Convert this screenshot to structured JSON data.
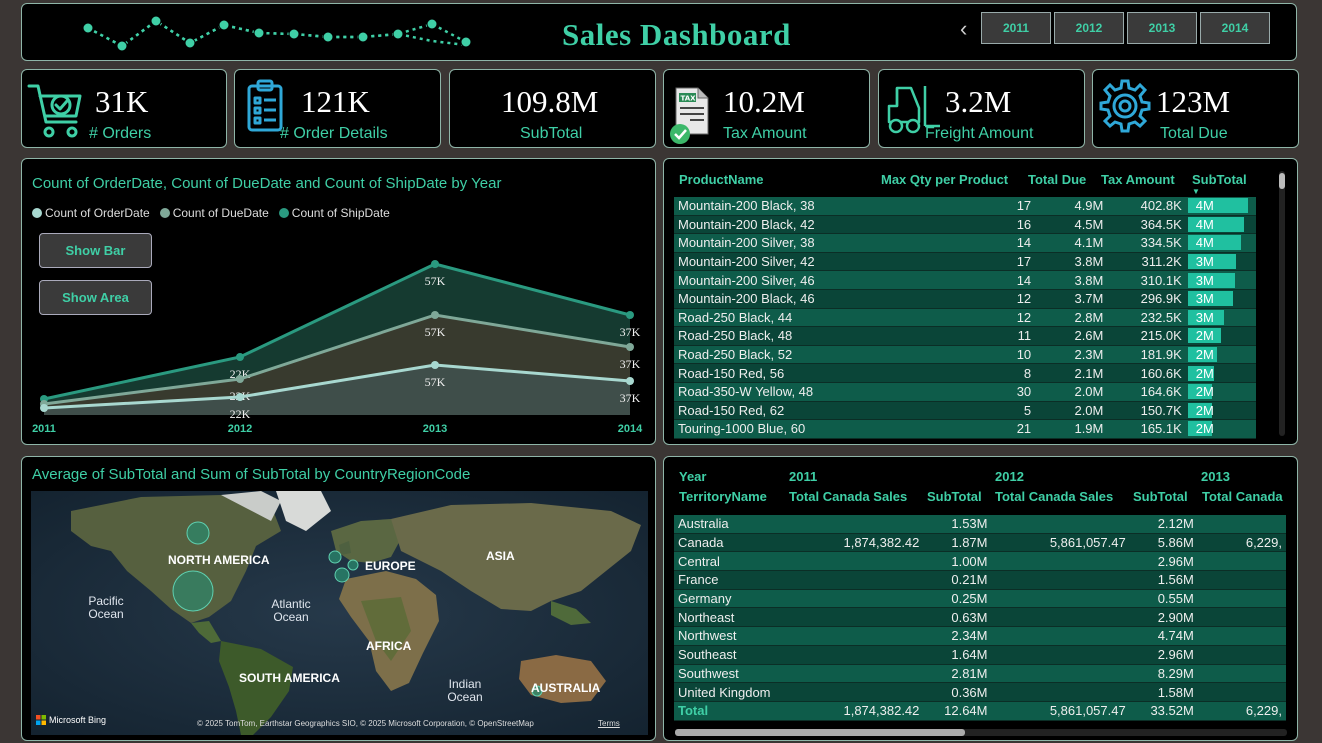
{
  "header": {
    "title": "Sales Dashboard",
    "years": [
      "2011",
      "2012",
      "2013",
      "2014"
    ]
  },
  "kpis": [
    {
      "value": "31K",
      "label": "# Orders",
      "icon": "cart-check-icon"
    },
    {
      "value": "121K",
      "label": "# Order Details",
      "icon": "clipboard-list-icon"
    },
    {
      "value": "109.8M",
      "label": "SubTotal",
      "icon": ""
    },
    {
      "value": "10.2M",
      "label": "Tax Amount",
      "icon": "tax-document-icon"
    },
    {
      "value": "3.2M",
      "label": "Freight Amount",
      "icon": "forklift-icon"
    },
    {
      "value": "123M",
      "label": "Total Due",
      "icon": "gear-icon"
    }
  ],
  "line_chart": {
    "title": "Count of OrderDate, Count of DueDate and Count of ShipDate by Year",
    "buttons": {
      "show_bar": "Show Bar",
      "show_area": "Show Area"
    }
  },
  "chart_data": {
    "type": "area",
    "title": "Count of OrderDate, Count of DueDate and Count of ShipDate by Year",
    "categories": [
      "2011",
      "2012",
      "2013",
      "2014"
    ],
    "series": [
      {
        "name": "Count of OrderDate",
        "color": "#a8d8d0",
        "values": [
          1600,
          22000,
          57000,
          37000
        ],
        "labels": [
          "",
          "22K",
          "57K",
          "37K"
        ]
      },
      {
        "name": "Count of DueDate",
        "color": "#7fa898",
        "values": [
          1700,
          22000,
          57000,
          37000
        ],
        "labels": [
          "",
          "22K",
          "57K",
          "37K"
        ]
      },
      {
        "name": "Count of ShipDate",
        "color": "#2a9a80",
        "values": [
          1800,
          22000,
          57000,
          37000
        ],
        "labels": [
          "",
          "22K",
          "57K",
          "37K"
        ]
      }
    ],
    "legend": "top-left",
    "grid": false
  },
  "product_table": {
    "columns": [
      "ProductName",
      "Max Qty per Product",
      "Total Due",
      "Tax Amount",
      "SubTotal"
    ],
    "rows": [
      {
        "name": "Mountain-200 Black, 38",
        "qty": "17",
        "due": "4.9M",
        "tax": "402.8K",
        "sub": "4M",
        "subv": 4.0
      },
      {
        "name": "Mountain-200 Black, 42",
        "qty": "16",
        "due": "4.5M",
        "tax": "364.5K",
        "sub": "4M",
        "subv": 3.7
      },
      {
        "name": "Mountain-200 Silver, 38",
        "qty": "14",
        "due": "4.1M",
        "tax": "334.5K",
        "sub": "4M",
        "subv": 3.5
      },
      {
        "name": "Mountain-200 Silver, 42",
        "qty": "17",
        "due": "3.8M",
        "tax": "311.2K",
        "sub": "3M",
        "subv": 3.2
      },
      {
        "name": "Mountain-200 Silver, 46",
        "qty": "14",
        "due": "3.8M",
        "tax": "310.1K",
        "sub": "3M",
        "subv": 3.1
      },
      {
        "name": "Mountain-200 Black, 46",
        "qty": "12",
        "due": "3.7M",
        "tax": "296.9K",
        "sub": "3M",
        "subv": 3.0
      },
      {
        "name": "Road-250 Black, 44",
        "qty": "12",
        "due": "2.8M",
        "tax": "232.5K",
        "sub": "3M",
        "subv": 2.4
      },
      {
        "name": "Road-250 Black, 48",
        "qty": "11",
        "due": "2.6M",
        "tax": "215.0K",
        "sub": "2M",
        "subv": 2.2
      },
      {
        "name": "Road-250 Black, 52",
        "qty": "10",
        "due": "2.3M",
        "tax": "181.9K",
        "sub": "2M",
        "subv": 1.9
      },
      {
        "name": "Road-150 Red, 56",
        "qty": "8",
        "due": "2.1M",
        "tax": "160.6K",
        "sub": "2M",
        "subv": 1.7
      },
      {
        "name": "Road-350-W Yellow, 48",
        "qty": "30",
        "due": "2.0M",
        "tax": "164.6K",
        "sub": "2M",
        "subv": 1.6
      },
      {
        "name": "Road-150 Red, 62",
        "qty": "5",
        "due": "2.0M",
        "tax": "150.7K",
        "sub": "2M",
        "subv": 1.6
      },
      {
        "name": "Touring-1000 Blue, 60",
        "qty": "21",
        "due": "1.9M",
        "tax": "165.1K",
        "sub": "2M",
        "subv": 1.6
      }
    ]
  },
  "map": {
    "title": "Average of SubTotal and Sum of SubTotal by CountryRegionCode",
    "continents": [
      "NORTH AMERICA",
      "EUROPE",
      "ASIA",
      "AFRICA",
      "SOUTH AMERICA",
      "AUSTRALIA"
    ],
    "oceans": [
      "Pacific Ocean",
      "Atlantic Ocean",
      "Indian Ocean"
    ],
    "brand": "Microsoft Bing",
    "copyright": "© 2025 TomTom, Earthstar Geographics SIO, © 2025 Microsoft Corporation, © OpenStreetMap",
    "terms": "Terms"
  },
  "territory_table": {
    "year_label": "Year",
    "row_header": "TerritoryName",
    "years": [
      "2011",
      "2012",
      "2013"
    ],
    "col_canada": "Total Canada Sales",
    "col_canada_cut": "Total Canada",
    "col_sub": "SubTotal",
    "rows": [
      {
        "name": "Australia",
        "c11": "",
        "s11": "1.53M",
        "c12": "",
        "s12": "2.12M",
        "c13": ""
      },
      {
        "name": "Canada",
        "c11": "1,874,382.42",
        "s11": "1.87M",
        "c12": "5,861,057.47",
        "s12": "5.86M",
        "c13": "6,229,"
      },
      {
        "name": "Central",
        "c11": "",
        "s11": "1.00M",
        "c12": "",
        "s12": "2.96M",
        "c13": ""
      },
      {
        "name": "France",
        "c11": "",
        "s11": "0.21M",
        "c12": "",
        "s12": "1.56M",
        "c13": ""
      },
      {
        "name": "Germany",
        "c11": "",
        "s11": "0.25M",
        "c12": "",
        "s12": "0.55M",
        "c13": ""
      },
      {
        "name": "Northeast",
        "c11": "",
        "s11": "0.63M",
        "c12": "",
        "s12": "2.90M",
        "c13": ""
      },
      {
        "name": "Northwest",
        "c11": "",
        "s11": "2.34M",
        "c12": "",
        "s12": "4.74M",
        "c13": ""
      },
      {
        "name": "Southeast",
        "c11": "",
        "s11": "1.64M",
        "c12": "",
        "s12": "2.96M",
        "c13": ""
      },
      {
        "name": "Southwest",
        "c11": "",
        "s11": "2.81M",
        "c12": "",
        "s12": "8.29M",
        "c13": ""
      },
      {
        "name": "United Kingdom",
        "c11": "",
        "s11": "0.36M",
        "c12": "",
        "s12": "1.58M",
        "c13": ""
      }
    ],
    "total": {
      "name": "Total",
      "c11": "1,874,382.42",
      "s11": "12.64M",
      "c12": "5,861,057.47",
      "s12": "33.52M",
      "c13": "6,229,"
    }
  }
}
